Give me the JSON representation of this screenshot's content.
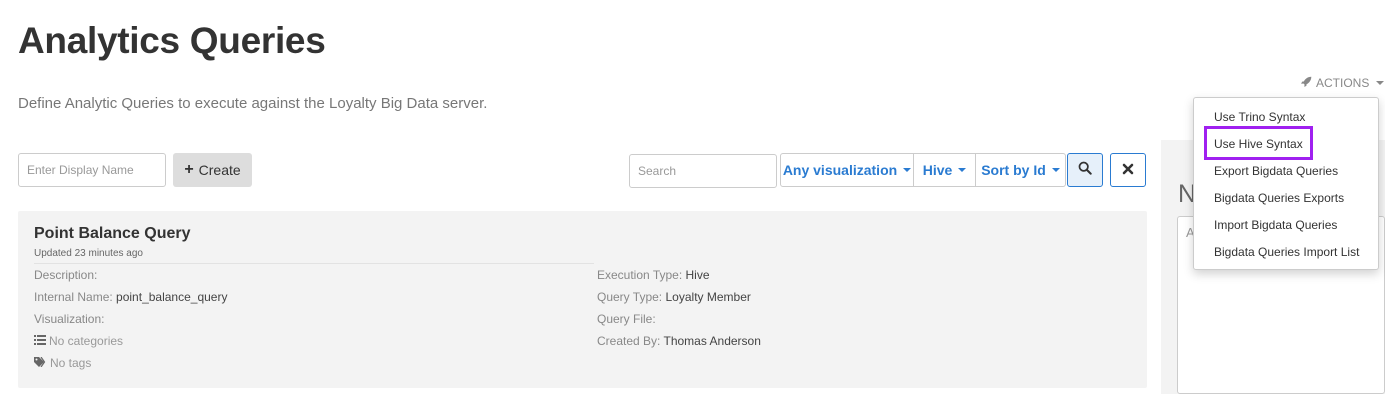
{
  "header": {
    "title": "Analytics Queries",
    "description": "Define Analytic Queries to execute against the Loyalty Big Data server."
  },
  "actions": {
    "label": "ACTIONS",
    "icon": "rocket-icon",
    "menu": [
      "Use Trino Syntax",
      "Use Hive Syntax",
      "Export Bigdata Queries",
      "Bigdata Queries Exports",
      "Import Bigdata Queries",
      "Bigdata Queries Import List"
    ],
    "highlighted_index": 1,
    "highlight_color": "#a020f0"
  },
  "toolbar": {
    "display_name_placeholder": "Enter Display Name",
    "create_label": "Create",
    "search_placeholder": "Search",
    "visualization_filter": "Any visualization",
    "engine_filter": "Hive",
    "sort_label": "Sort by Id",
    "accent_color": "#2a7bd1"
  },
  "query_card": {
    "title": "Point Balance Query",
    "updated": "Updated 23 minutes ago",
    "left_fields": [
      {
        "label": "Description:",
        "value": ""
      },
      {
        "label": "Internal Name:",
        "value": "point_balance_query"
      },
      {
        "label": "Visualization:",
        "value": ""
      }
    ],
    "categories": "No categories",
    "tags": "No tags",
    "right_fields": [
      {
        "label": "Execution Type:",
        "value": "Hive"
      },
      {
        "label": "Query Type:",
        "value": "Loyalty Member"
      },
      {
        "label": "Query File:",
        "value": ""
      },
      {
        "label": "Created By:",
        "value": "Thomas Anderson"
      }
    ]
  },
  "side_panel": {
    "heading_fragment": "N",
    "input_fragment": "A"
  }
}
